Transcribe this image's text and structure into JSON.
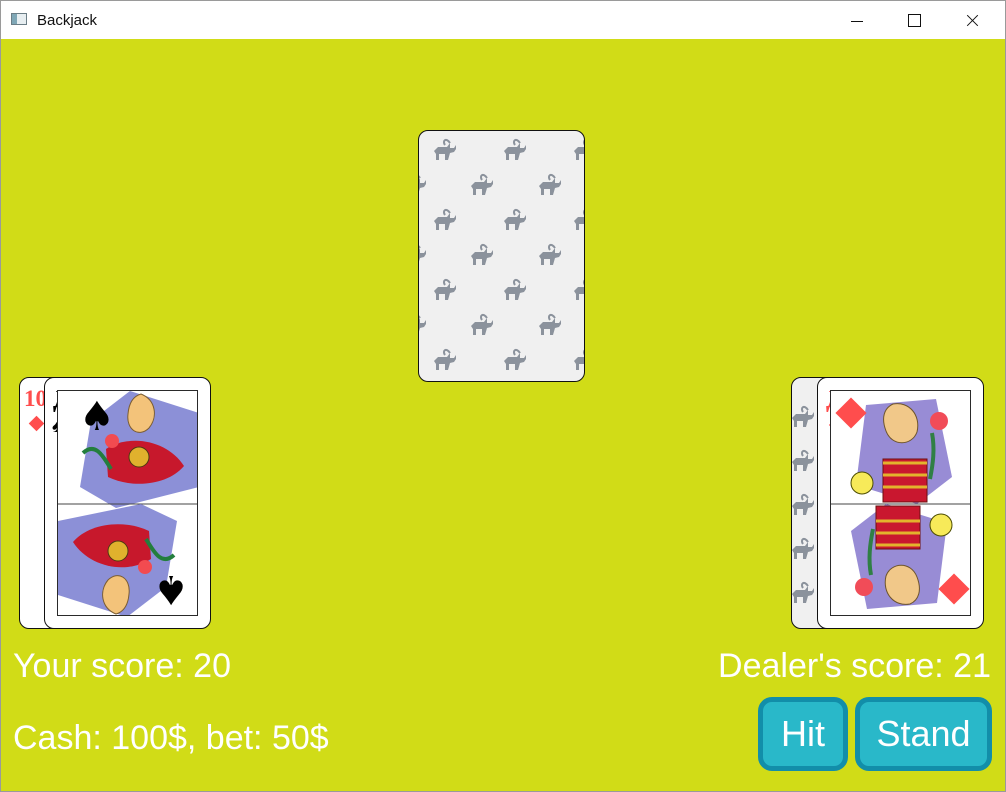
{
  "window": {
    "title": "Backjack",
    "icon": "app-icon",
    "controls": [
      "minimize-icon",
      "maximize-icon",
      "close-icon"
    ]
  },
  "colors": {
    "table": "#d1dc17",
    "label": "#ffffff",
    "button": "#29b8c9",
    "button_border": "#128ea9",
    "card_back_pattern": "#8b929c",
    "red_suit": "#ff4d4d"
  },
  "dealer_hand": {
    "cards": [
      {
        "type": "back"
      }
    ]
  },
  "player_hand": {
    "cards": [
      {
        "rank": "10",
        "suit": "diamonds"
      },
      {
        "rank": "Д",
        "suit": "spades"
      }
    ]
  },
  "dealer_right_hand": {
    "cards": [
      {
        "type": "back"
      },
      {
        "rank": "Д",
        "suit": "diamonds"
      }
    ]
  },
  "scores": {
    "your": "Your score: 20",
    "dealer": "Dealer's score: 21",
    "cash": "Cash: 100$, bet: 50$"
  },
  "buttons": {
    "hit": "Hit",
    "stand": "Stand"
  }
}
